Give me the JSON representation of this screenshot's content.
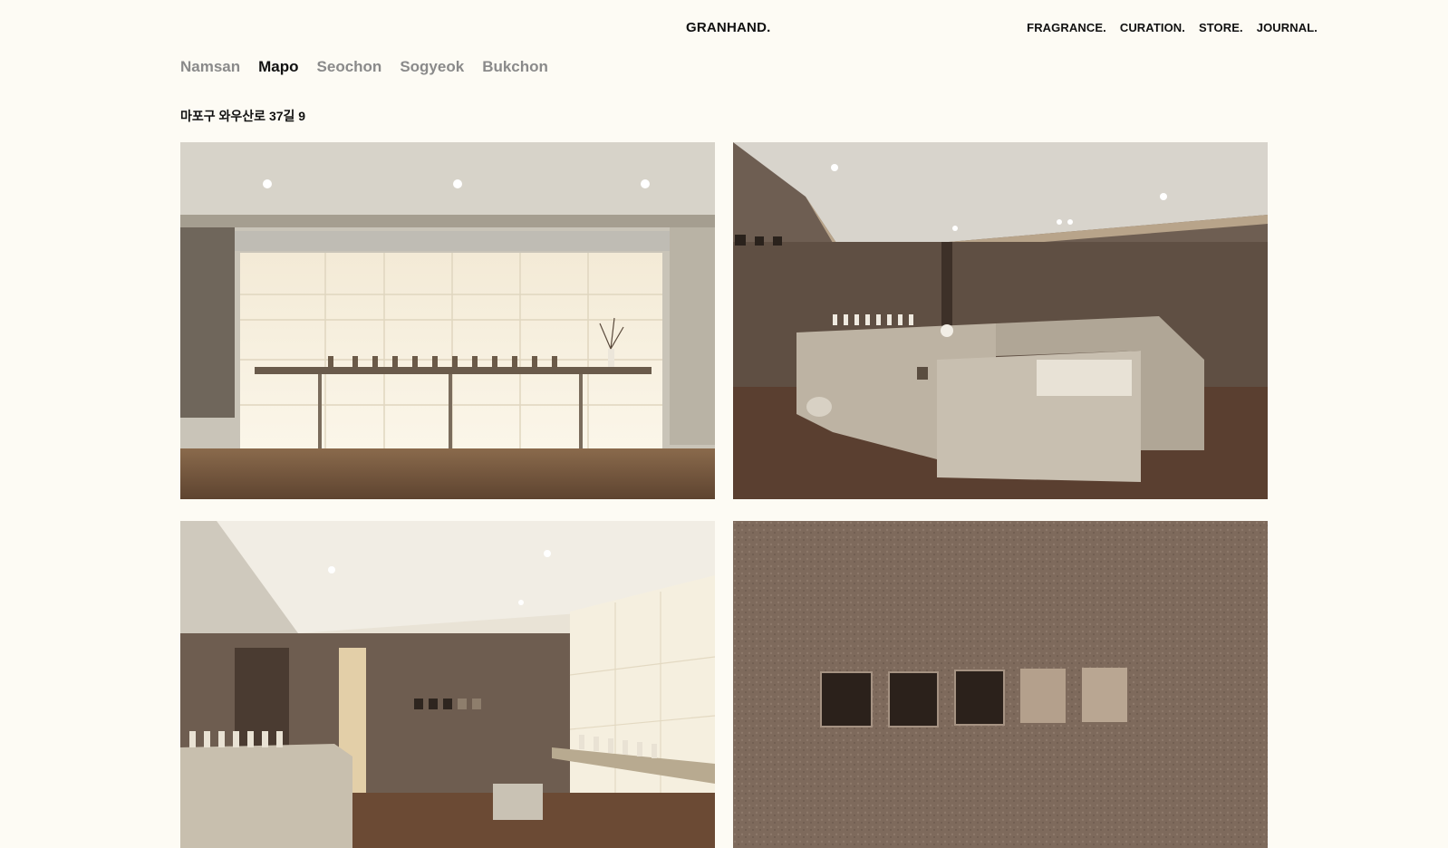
{
  "header": {
    "logo": "GRANHAND.",
    "nav": [
      "FRAGRANCE.",
      "CURATION.",
      "STORE.",
      "JOURNAL."
    ]
  },
  "locations": {
    "items": [
      "Namsan",
      "Mapo",
      "Seochon",
      "Sogyeok",
      "Bukchon"
    ],
    "active": "Mapo"
  },
  "store": {
    "address": "마포구 와우산로 37길 9"
  },
  "gallery": {
    "photos": [
      "store-interior-lit-wall-display",
      "store-interior-stone-counter",
      "store-interior-corridor-shelves",
      "textured-wall-square-niches"
    ]
  },
  "colors": {
    "background": "#fdfbf4",
    "text": "#111111",
    "inactive": "#8a8a8a"
  }
}
